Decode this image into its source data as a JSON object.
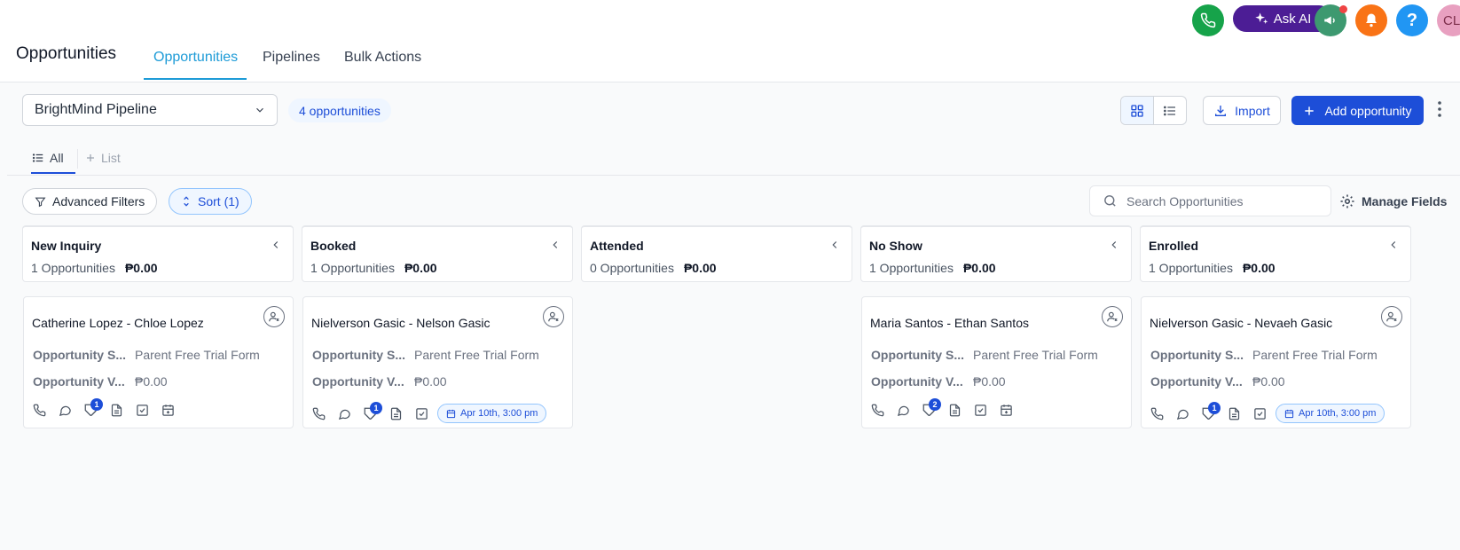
{
  "header": {
    "page_title": "Opportunities",
    "tabs": [
      {
        "label": "Opportunities"
      },
      {
        "label": "Pipelines"
      },
      {
        "label": "Bulk Actions"
      }
    ],
    "ask_ai_label": "Ask AI",
    "avatar_initials": "CL",
    "help_label": "?"
  },
  "toolbar": {
    "pipeline": "BrightMind Pipeline",
    "count": "4 opportunities",
    "import_label": "Import",
    "add_label": "Add opportunity"
  },
  "views": {
    "all_label": "All",
    "list_label": "List"
  },
  "filters": {
    "advanced_label": "Advanced Filters",
    "sort_label": "Sort (1)",
    "search_placeholder": "Search Opportunities",
    "manage_fields_label": "Manage Fields"
  },
  "columns": [
    {
      "name": "New Inquiry",
      "count": "1 Opportunities",
      "amount": "₱0.00"
    },
    {
      "name": "Booked",
      "count": "1 Opportunities",
      "amount": "₱0.00"
    },
    {
      "name": "Attended",
      "count": "0 Opportunities",
      "amount": "₱0.00"
    },
    {
      "name": "No Show",
      "count": "1 Opportunities",
      "amount": "₱0.00"
    },
    {
      "name": "Enrolled",
      "count": "1 Opportunities",
      "amount": "₱0.00"
    }
  ],
  "field_labels": {
    "source": "Opportunity S...",
    "value": "Opportunity V..."
  },
  "cards": [
    {
      "title": "Catherine Lopez - Chloe Lopez",
      "source": "Parent Free Trial Form",
      "value": "₱0.00",
      "badge": "1",
      "appointment": ""
    },
    {
      "title": "Nielverson Gasic - Nelson Gasic",
      "source": "Parent Free Trial Form",
      "value": "₱0.00",
      "badge": "1",
      "appointment": "Apr 10th, 3:00 pm"
    },
    {
      "title": "Maria Santos - Ethan Santos",
      "source": "Parent Free Trial Form",
      "value": "₱0.00",
      "badge": "2",
      "appointment": ""
    },
    {
      "title": "Nielverson Gasic - Nevaeh Gasic",
      "source": "Parent Free Trial Form",
      "value": "₱0.00",
      "badge": "1",
      "appointment": "Apr 10th, 3:00 pm"
    }
  ],
  "colors": {
    "accent": "#1d4ed8",
    "tab_active": "#1d9bd7",
    "phone_btn": "#16a34a",
    "ask_ai_bg": "#4c1d95",
    "announce_btn": "#3d9970",
    "bell_btn": "#f97316",
    "help_btn": "#2196f3",
    "avatar_bg": "#e8a0c0"
  }
}
